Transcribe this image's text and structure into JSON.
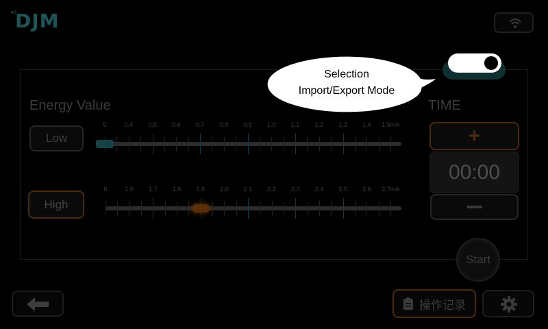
{
  "logo": {
    "superscript": "4G",
    "text": "DJM"
  },
  "panel": {
    "energy_title": "Energy Value",
    "time_title": "TIME",
    "low_label": "Low",
    "high_label": "High",
    "low_scale": {
      "labels": [
        "0",
        "0.4",
        "0.5",
        "0.6",
        "0.7",
        "0.8",
        "0.9",
        "1.0",
        "1.1",
        "1.2",
        "1.3",
        "1.4",
        "1.5mA"
      ],
      "value": "0"
    },
    "high_scale": {
      "labels": [
        "0",
        "1.6",
        "1.7",
        "1.8",
        "1.9",
        "2.0",
        "2.1",
        "2.2",
        "2.3",
        "2.4",
        "2.5",
        "2.6",
        "2.7mA"
      ],
      "value": "1.9"
    },
    "time_value": "00:00",
    "plus_symbol": "+",
    "start_label": "Start"
  },
  "toggle": {
    "label": "Selection",
    "state": "on"
  },
  "callout": {
    "line1": "Selection",
    "line2": "Import/Export Mode"
  },
  "footer": {
    "records_label": "操作记录"
  },
  "icons": {
    "wifi": "wifi-icon",
    "back": "back-arrow-icon",
    "records": "clipboard-icon",
    "settings": "gear-icon"
  },
  "colors": {
    "accent_orange": "#4a2b08",
    "accent_teal": "#154246",
    "background": "#000000"
  }
}
